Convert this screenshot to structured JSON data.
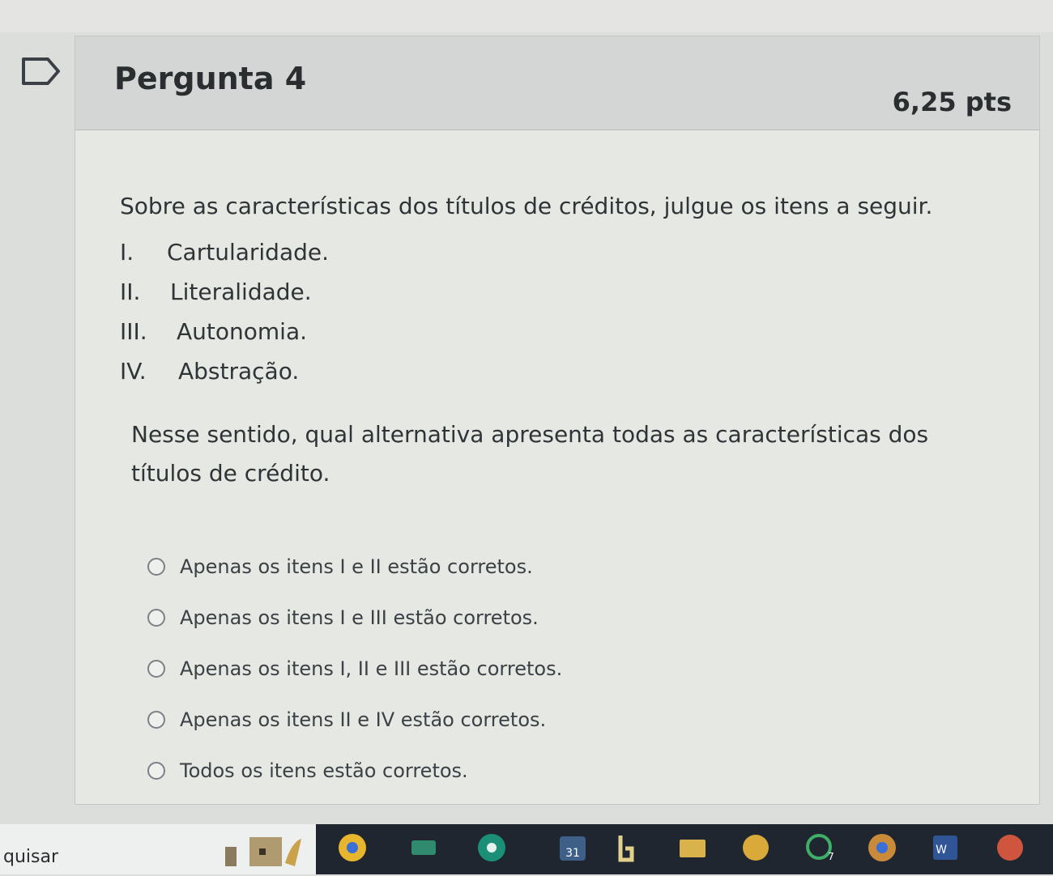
{
  "question": {
    "title": "Pergunta 4",
    "points": "6,25 pts",
    "prompt": "Sobre as características dos títulos de créditos, julgue os itens a seguir.",
    "items": [
      {
        "numeral": "I.",
        "text": "Cartularidade."
      },
      {
        "numeral": "II.",
        "text": "Literalidade."
      },
      {
        "numeral": "III.",
        "text": "Autonomia."
      },
      {
        "numeral": "IV.",
        "text": "Abstração."
      }
    ],
    "instruction": "Nesse sentido, qual alternativa apresenta todas as características dos títulos de crédito.",
    "answers": [
      {
        "label": "Apenas os itens I e II estão corretos."
      },
      {
        "label": "Apenas os itens I e III estão corretos."
      },
      {
        "label": "Apenas os itens I, II e III estão corretos."
      },
      {
        "label": "Apenas os itens II e IV estão corretos."
      },
      {
        "label": "Todos os itens estão corretos."
      }
    ]
  },
  "taskbar": {
    "search_text": "quisar",
    "calendar_badge": "31",
    "notification_badge": "7",
    "word_badge": "W"
  },
  "colors": {
    "header_bg": "#d3d6d4",
    "card_bg": "#e6e8e4",
    "taskbar_bg": "#1f2630"
  }
}
